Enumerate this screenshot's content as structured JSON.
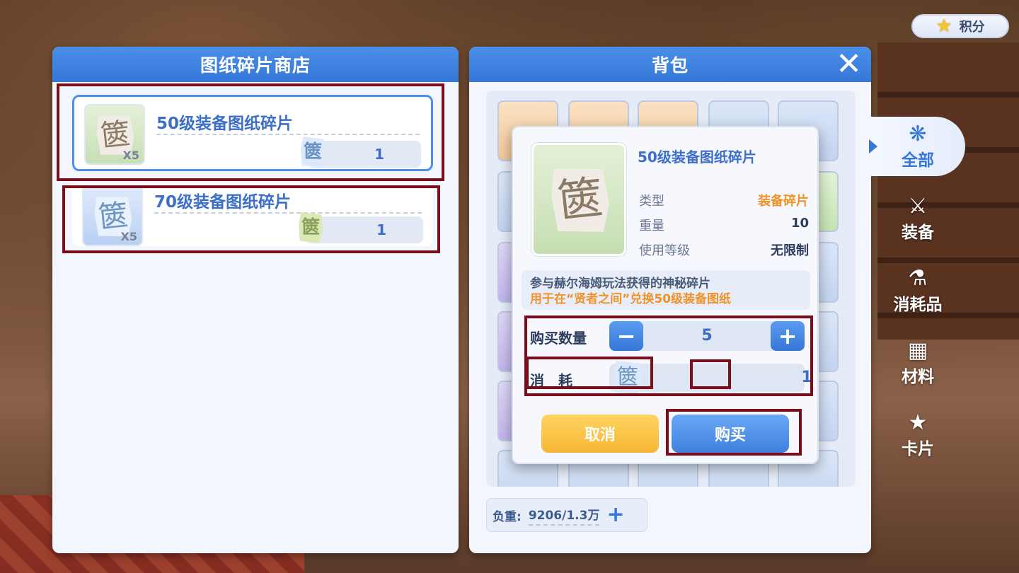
{
  "points": {
    "icon": "star-icon",
    "label": "积分"
  },
  "shop": {
    "title": "图纸碎片商店",
    "items": [
      {
        "name": "50级装备图纸碎片",
        "count": "X5",
        "price": "1",
        "icon_glyph": "篋",
        "selected": true
      },
      {
        "name": "70级装备图纸碎片",
        "count": "X5",
        "price": "1",
        "icon_glyph": "篋",
        "selected": false
      }
    ]
  },
  "bag": {
    "title": "背包",
    "close_icon": "close-icon",
    "weight_label": "负重:",
    "weight_value": "9206/1.3万",
    "weight_add": "+"
  },
  "tabs": [
    {
      "label": "全部",
      "icon": "swirl-icon",
      "glyph": "❋",
      "active": true
    },
    {
      "label": "装备",
      "icon": "equipment-icon",
      "glyph": "⚔",
      "active": false
    },
    {
      "label": "消耗品",
      "icon": "flask-icon",
      "glyph": "⚗",
      "active": false
    },
    {
      "label": "材料",
      "icon": "grid-icon",
      "glyph": "▦",
      "active": false
    },
    {
      "label": "卡片",
      "icon": "card-icon",
      "glyph": "★",
      "active": false
    }
  ],
  "popup": {
    "title": "50级装备图纸碎片",
    "rows": [
      {
        "label": "类型",
        "value": "装备碎片"
      },
      {
        "label": "重量",
        "value": "10"
      },
      {
        "label": "使用等级",
        "value": "无限制"
      }
    ],
    "desc_line1": "参与赫尔海姆玩法获得的神秘碎片",
    "desc_line2": "用于在“贤者之间”兑换50级装备图纸",
    "qty_label": "购买数量",
    "qty_minus": "−",
    "qty_value": "5",
    "qty_plus": "+",
    "cost_label": "消　耗",
    "cost_value": "1",
    "cancel_label": "取消",
    "buy_label": "购买"
  },
  "colors": {
    "header_blue": "#3677d8",
    "title_blue": "#3d6fc9",
    "orange_text": "#f0922a",
    "cancel_yellow": "#f5b534",
    "highlight_red": "#7a0e1a"
  }
}
